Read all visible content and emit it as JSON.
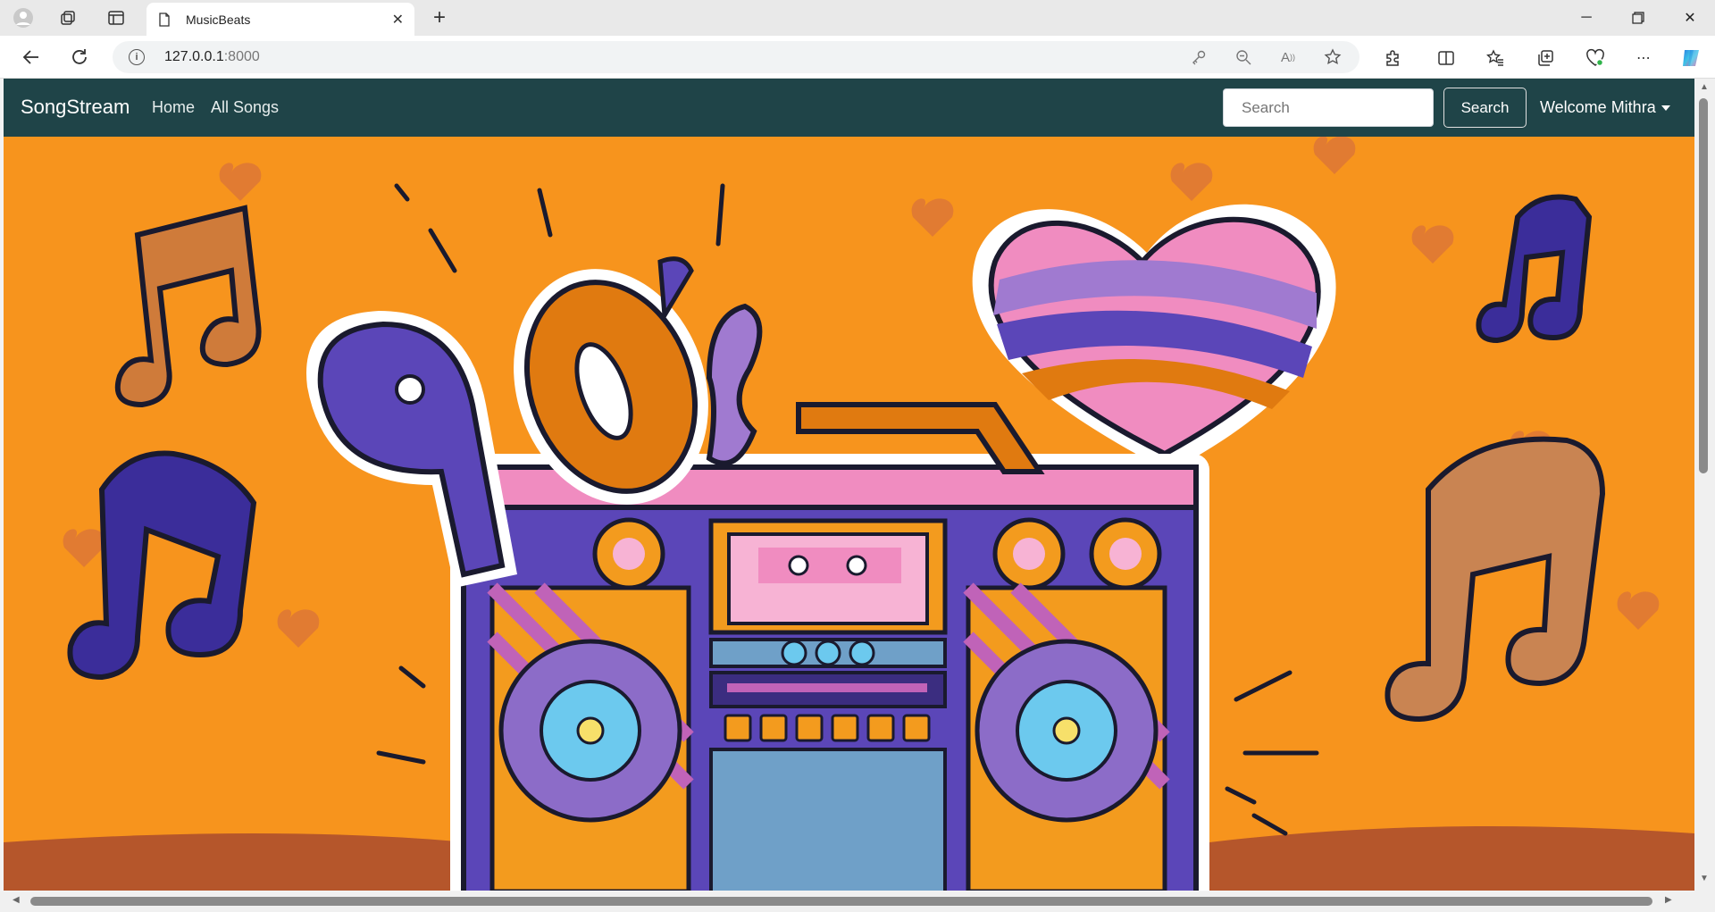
{
  "browser": {
    "tab_title": "MusicBeats",
    "url_host": "127.0.0.1",
    "url_port": ":8000"
  },
  "navbar": {
    "brand": "SongStream",
    "links": [
      "Home",
      "All Songs"
    ],
    "search_placeholder": "Search",
    "search_button": "Search",
    "user_menu": "Welcome Mithra"
  },
  "hero": {
    "graphic_text": "90's",
    "icons": [
      "boombox-icon",
      "heart-icon",
      "music-note-icon",
      "cassette-icon"
    ]
  },
  "colors": {
    "navbar_bg": "#1f4448",
    "hero_bg": "#f7941d",
    "purple": "#5b46b8",
    "orange": "#e07a10",
    "pink": "#f08cc0"
  }
}
